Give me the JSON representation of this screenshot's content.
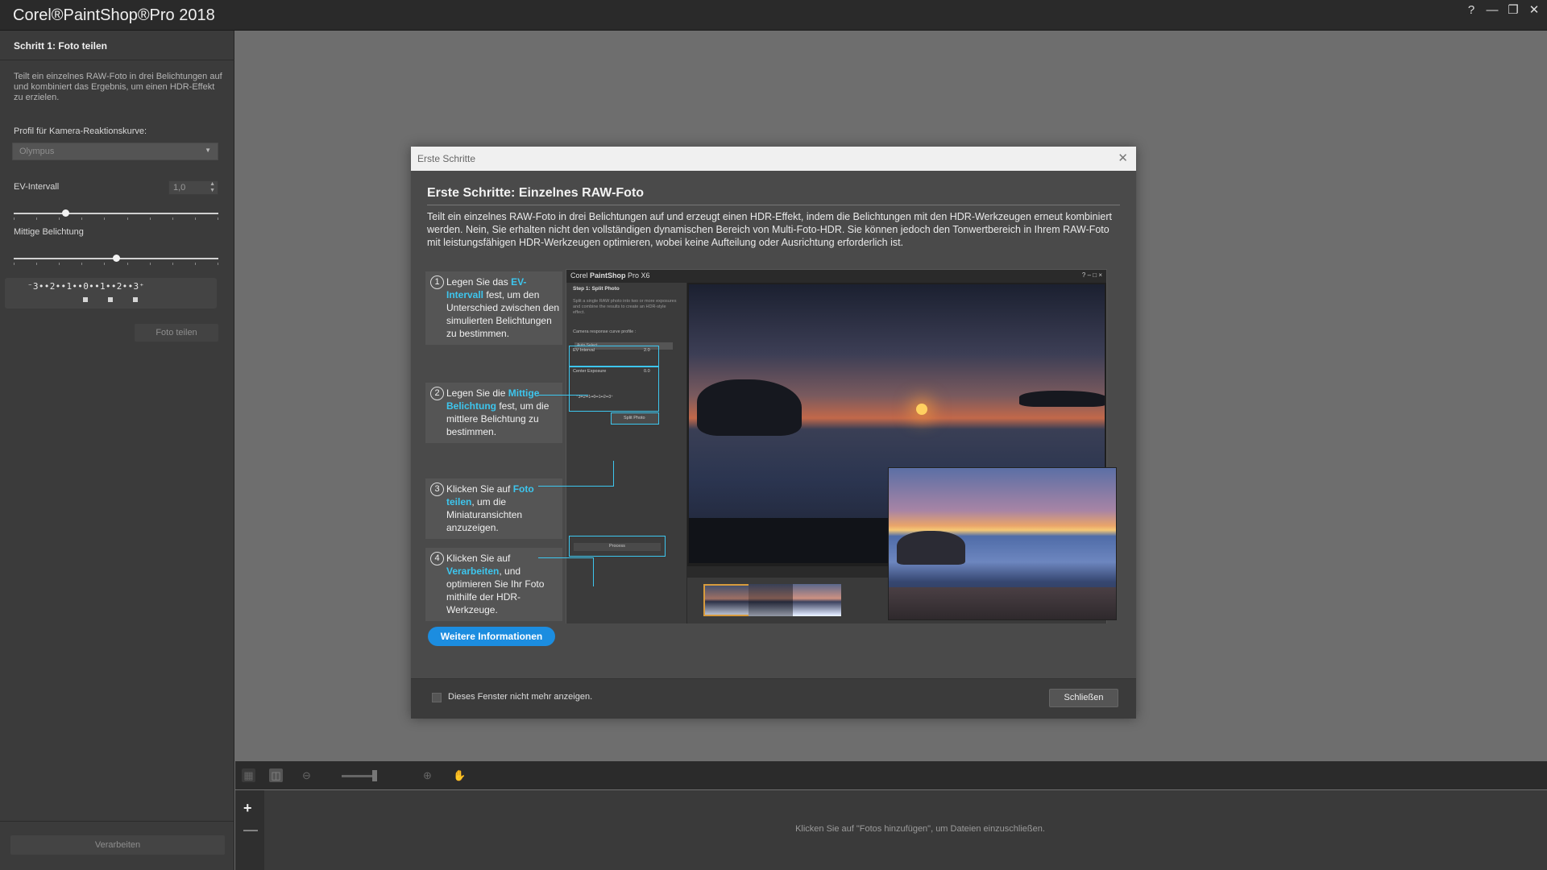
{
  "app": {
    "title": "Corel®PaintShop®Pro 2018",
    "window_buttons": [
      "?",
      "—",
      "❐",
      "✕"
    ]
  },
  "left_panel": {
    "title": "Schritt 1: Foto teilen",
    "description": "Teilt ein einzelnes RAW-Foto in drei Belichtungen auf und kombiniert das Ergebnis, um einen HDR-Effekt zu erzielen.",
    "profile_label": "Profil für Kamera-Reaktionskurve:",
    "profile_value": "Olympus",
    "ev_label": "EV-Intervall",
    "ev_value": "1,0",
    "ev_slider_fraction": 0.25,
    "center_label": "Mittige Belichtung",
    "center_slider_fraction": 0.5,
    "scale_text": "⁻3••2••1••0••1••2••3⁺",
    "split_button": "Foto teilen",
    "process_button": "Verarbeiten"
  },
  "bottom": {
    "hint": "Klicken Sie auf \"Fotos hinzufügen\", um Dateien einzuschließen.",
    "add": "+",
    "remove": "—"
  },
  "dialog": {
    "window_title": "Erste Schritte",
    "heading": "Erste Schritte: Einzelnes RAW-Foto",
    "intro": "Teilt ein einzelnes RAW-Foto in drei Belichtungen auf und erzeugt einen HDR-Effekt, indem die Belichtungen mit den HDR-Werkzeugen erneut kombiniert werden. Nein, Sie erhalten nicht den vollständigen dynamischen Bereich von Multi-Foto-HDR. Sie können jedoch den Tonwertbereich in Ihrem RAW-Foto mit leistungsfähigen HDR-Werkzeugen optimieren, wobei keine Aufteilung oder Ausrichtung erforderlich ist.",
    "steps": [
      {
        "num": "1",
        "pre": "Legen Sie das ",
        "hl": "EV-Intervall",
        "post": " fest, um den Unterschied zwischen den simulierten Belichtungen zu bestimmen."
      },
      {
        "num": "2",
        "pre": "Legen Sie die ",
        "hl": "Mittige Belichtung",
        "post": " fest, um die mittlere Belichtung zu bestimmen."
      },
      {
        "num": "3",
        "pre": "Klicken Sie auf ",
        "hl": "Foto teilen",
        "post": ", um die Miniaturansichten anzuzeigen."
      },
      {
        "num": "4",
        "pre": "Klicken Sie auf ",
        "hl": "Verarbeiten",
        "post": ", und optimieren Sie Ihr Foto mithilfe der HDR-Werkzeuge."
      }
    ],
    "more_button": "Weitere Informationen",
    "dont_show": "Dieses Fenster nicht mehr anzeigen.",
    "close_button": "Schließen",
    "accent_color": "#3dc6ee",
    "button_color": "#1c8de0",
    "mini": {
      "title_prefix": "Corel ",
      "title_bold": "PaintShop",
      "title_suffix": " Pro X6",
      "buttons": "? – □ ×",
      "step_title": "Step 1: Split Photo",
      "desc": "Split a single RAW photo into two or more exposures and combine the results to create an HDR-style effect.",
      "curve_label": "Camera response curve profile :",
      "curve_value": "Auto Select",
      "ev_label": "EV Interval",
      "ev_value": "2.0",
      "center_label": "Center Exposure",
      "center_value": "0.0",
      "scale": "⁻3••2••1••0••1••2••3⁺",
      "split_button": "Split Photo",
      "process_button": "Process"
    }
  }
}
